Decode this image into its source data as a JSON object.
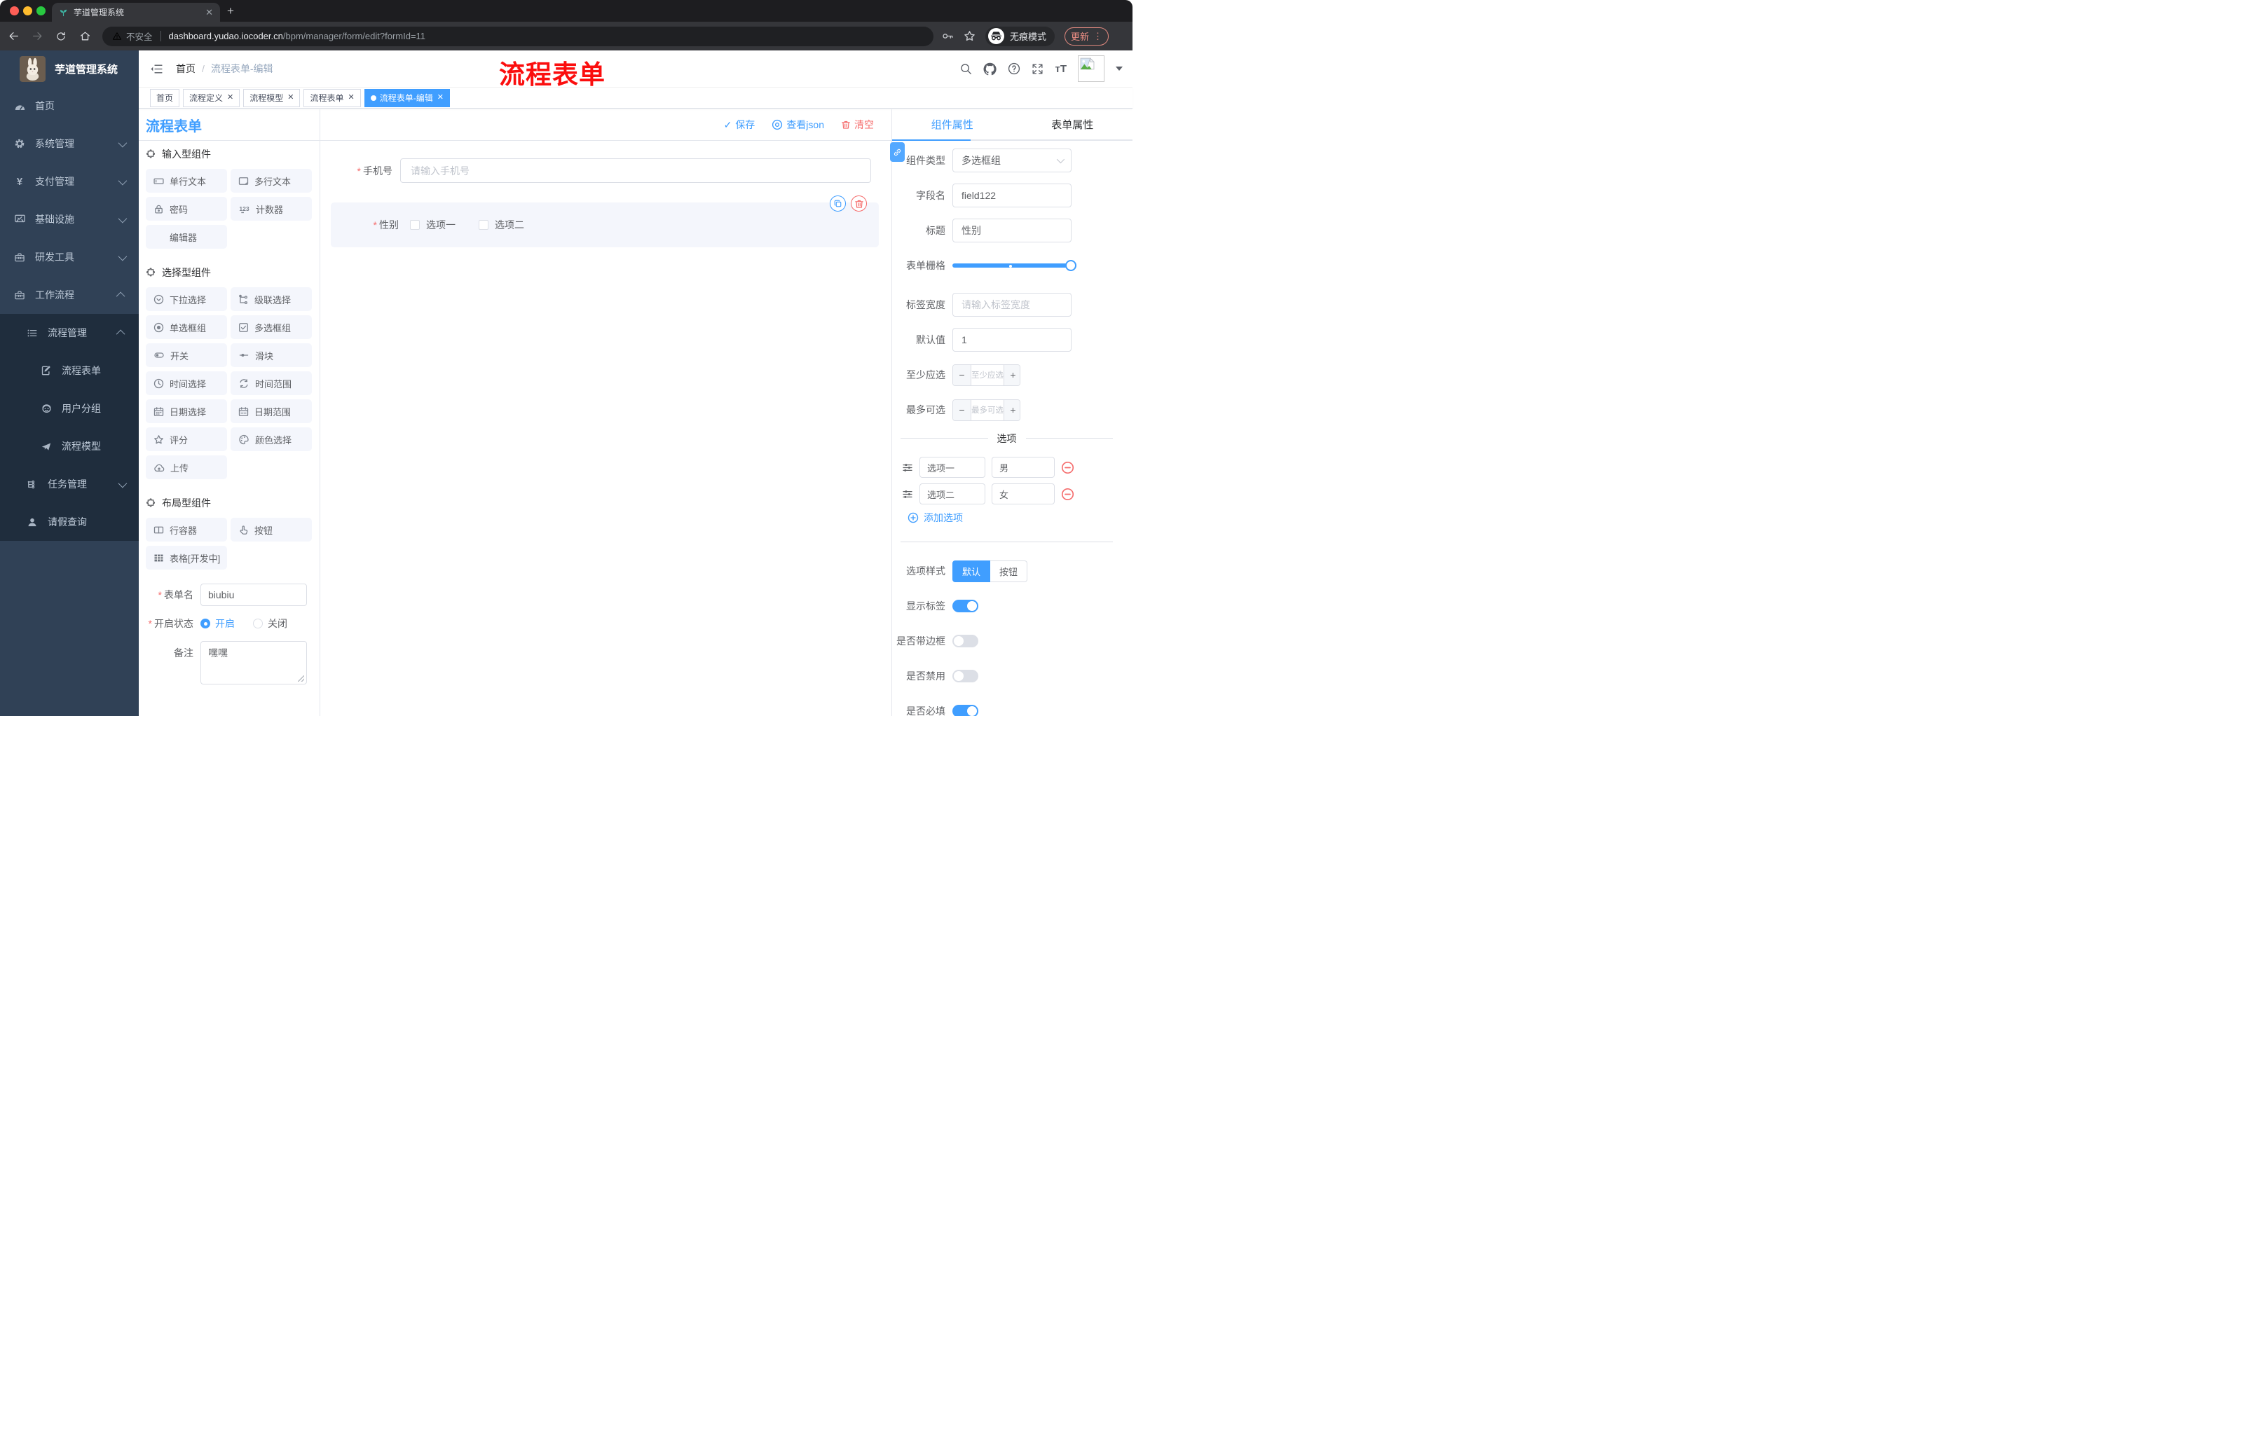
{
  "browser": {
    "tab": {
      "title": "芋道管理系统"
    },
    "new_tab": "+",
    "security": "不安全",
    "url_host": "dashboard.yudao.iocoder.cn",
    "url_path": "/bpm/manager/form/edit?formId=11",
    "incognito": "无痕模式",
    "update": "更新",
    "menu_dots": "⋮"
  },
  "sidebar": {
    "app_title": "芋道管理系统",
    "items": [
      {
        "label": "首页",
        "icon": "dashboard",
        "level": 1
      },
      {
        "label": "系统管理",
        "icon": "gear",
        "level": 1,
        "chevron": "down"
      },
      {
        "label": "支付管理",
        "icon": "yen",
        "level": 1,
        "chevron": "down"
      },
      {
        "label": "基础设施",
        "icon": "monitor",
        "level": 1,
        "chevron": "down"
      },
      {
        "label": "研发工具",
        "icon": "toolbox",
        "level": 1,
        "chevron": "down"
      },
      {
        "label": "工作流程",
        "icon": "toolbox",
        "level": 1,
        "chevron": "up"
      },
      {
        "label": "流程管理",
        "icon": "list",
        "level": 2,
        "chevron": "up"
      },
      {
        "label": "流程表单",
        "icon": "document-edit",
        "level": 3
      },
      {
        "label": "用户分组",
        "icon": "robot",
        "level": 3
      },
      {
        "label": "流程模型",
        "icon": "paper-plane",
        "level": 3
      },
      {
        "label": "任务管理",
        "icon": "tree",
        "level": 2,
        "chevron": "down"
      },
      {
        "label": "请假查询",
        "icon": "user",
        "level": 2
      }
    ]
  },
  "header": {
    "breadcrumb_home": "首页",
    "breadcrumb_current": "流程表单-编辑",
    "watermark": "流程表单"
  },
  "tags": {
    "items": [
      {
        "label": "首页",
        "closable": false,
        "active": false
      },
      {
        "label": "流程定义",
        "closable": true,
        "active": false
      },
      {
        "label": "流程模型",
        "closable": true,
        "active": false
      },
      {
        "label": "流程表单",
        "closable": true,
        "active": false
      },
      {
        "label": "流程表单-编辑",
        "closable": true,
        "active": true
      }
    ]
  },
  "designer": {
    "panel_title": "流程表单",
    "toolbar": {
      "save": "保存",
      "view_json": "查看json",
      "clear": "清空"
    },
    "sections": [
      {
        "title": "输入型组件",
        "items": [
          {
            "label": "单行文本",
            "icon": "input"
          },
          {
            "label": "多行文本",
            "icon": "textarea"
          },
          {
            "label": "密码",
            "icon": "lock"
          },
          {
            "label": "计数器",
            "icon": "counter"
          },
          {
            "label": "编辑器",
            "icon": ""
          }
        ]
      },
      {
        "title": "选择型组件",
        "items": [
          {
            "label": "下拉选择",
            "icon": "select"
          },
          {
            "label": "级联选择",
            "icon": "cascader"
          },
          {
            "label": "单选框组",
            "icon": "radio"
          },
          {
            "label": "多选框组",
            "icon": "checkbox"
          },
          {
            "label": "开关",
            "icon": "switch"
          },
          {
            "label": "滑块",
            "icon": "slider"
          },
          {
            "label": "时间选择",
            "icon": "time"
          },
          {
            "label": "时间范围",
            "icon": "time-range"
          },
          {
            "label": "日期选择",
            "icon": "date"
          },
          {
            "label": "日期范围",
            "icon": "date-range"
          },
          {
            "label": "评分",
            "icon": "rate"
          },
          {
            "label": "颜色选择",
            "icon": "color"
          },
          {
            "label": "上传",
            "icon": "upload"
          }
        ]
      },
      {
        "title": "布局型组件",
        "items": [
          {
            "label": "行容器",
            "icon": "row"
          },
          {
            "label": "按钮",
            "icon": "button"
          },
          {
            "label": "表格[开发中]",
            "icon": "table"
          }
        ]
      }
    ],
    "meta": {
      "form_name_label": "表单名",
      "form_name_value": "biubiu",
      "status_label": "开启状态",
      "status_on": "开启",
      "status_off": "关闭",
      "status_checked": "开启",
      "remark_label": "备注",
      "remark_value": "嘿嘿"
    },
    "canvas": {
      "phone": {
        "label": "手机号",
        "placeholder": "请输入手机号"
      },
      "gender": {
        "label": "性别",
        "options": [
          "选项一",
          "选项二"
        ]
      }
    }
  },
  "props": {
    "tab_component": "组件属性",
    "tab_form": "表单属性",
    "rows": {
      "component_type": {
        "label": "组件类型",
        "value": "多选框组"
      },
      "field_name": {
        "label": "字段名",
        "value": "field122"
      },
      "title": {
        "label": "标题",
        "value": "性别"
      },
      "grid": {
        "label": "表单栅格"
      },
      "label_width": {
        "label": "标签宽度",
        "placeholder": "请输入标签宽度"
      },
      "default_value": {
        "label": "默认值",
        "value": "1"
      },
      "min": {
        "label": "至少应选",
        "placeholder": "至少应选"
      },
      "max": {
        "label": "最多可选",
        "placeholder": "最多可选"
      }
    },
    "options": {
      "divider": "选项",
      "rows": [
        {
          "label": "选项一",
          "value": "男"
        },
        {
          "label": "选项二",
          "value": "女"
        }
      ],
      "add": "添加选项"
    },
    "style": {
      "label": "选项样式",
      "seg_default": "默认",
      "seg_button": "按钮"
    },
    "switches": [
      {
        "label": "显示标签",
        "on": true
      },
      {
        "label": "是否带边框",
        "on": false
      },
      {
        "label": "是否禁用",
        "on": false
      },
      {
        "label": "是否必填",
        "on": true
      }
    ]
  },
  "colors": {
    "primary": "#409eff",
    "danger": "#f56c6c",
    "sidebar_bg": "#304156",
    "submenu_bg": "#1f2d3d",
    "watermark": "#fb0e0e",
    "component_bg": "#f4f6fc"
  }
}
